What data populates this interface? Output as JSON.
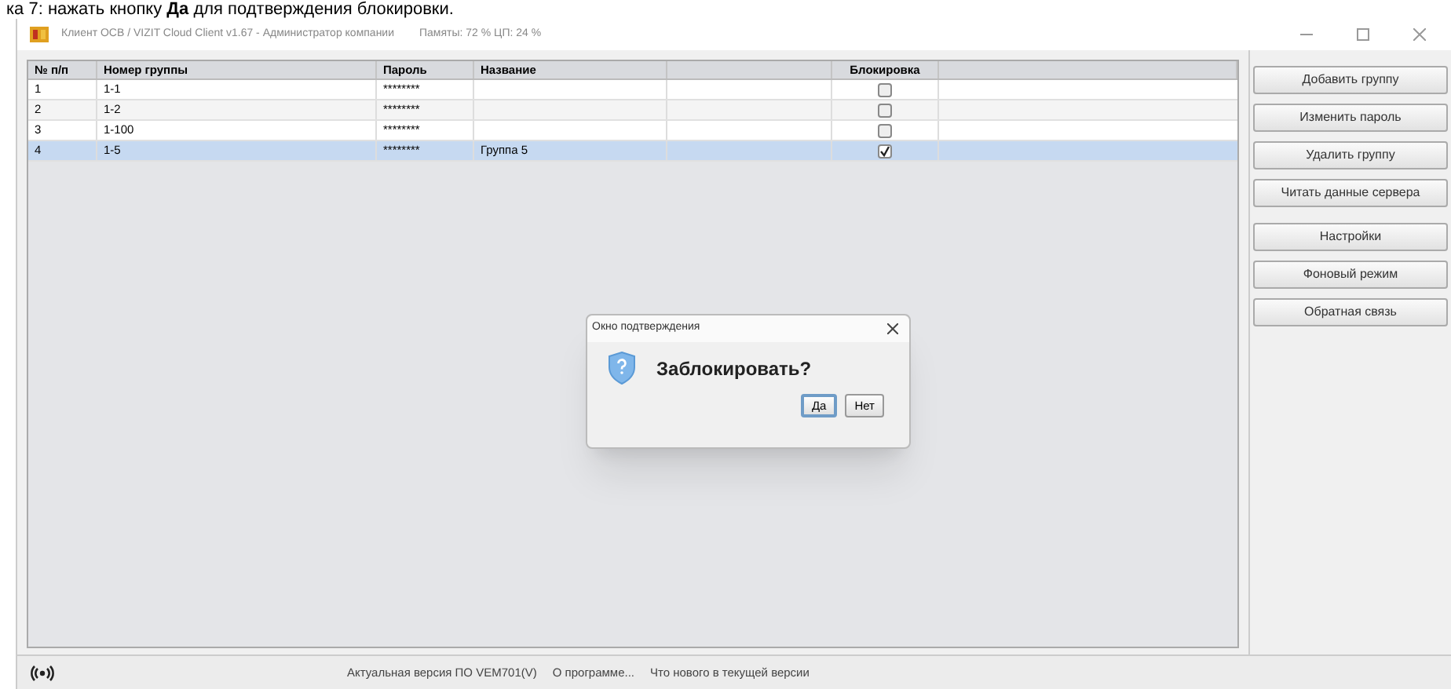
{
  "caption": "ка 7: нажать кнопку **Да** для подтверждения блокировки.",
  "window": {
    "title": "Клиент OCB / VIZIT Cloud Client v1.67 - Администратор компании",
    "memory": "Памяты: 72 %  ЦП: 24 %"
  },
  "table": {
    "columns": [
      "№ п/п",
      "Номер группы",
      "Пароль",
      "Название",
      "Блокировка"
    ],
    "rows": [
      {
        "n": "1",
        "group": "1-1",
        "password": "********",
        "name": "",
        "locked": false,
        "selected": false
      },
      {
        "n": "2",
        "group": "1-2",
        "password": "********",
        "name": "",
        "locked": false,
        "selected": false
      },
      {
        "n": "3",
        "group": "1-100",
        "password": "********",
        "name": "",
        "locked": false,
        "selected": false
      },
      {
        "n": "4",
        "group": "1-5",
        "password": "********",
        "name": "Группа 5",
        "locked": true,
        "selected": true
      }
    ]
  },
  "side_buttons": [
    [
      "Добавить группу",
      "Изменить пароль",
      "Удалить группу",
      "Читать данные сервера"
    ],
    [
      "Настройки",
      "Фоновый режим",
      "Обратная связь"
    ]
  ],
  "dialog": {
    "title": "Окно подтверждения",
    "message": "Заблокировать?",
    "buttons": [
      {
        "label": "Да",
        "selected": true
      },
      {
        "label": "Нет",
        "selected": false
      }
    ]
  },
  "status_bar": {
    "links": [
      "Актуальная версия ПО VEM701(V)",
      "О программе...",
      "Что нового в текущей версии"
    ]
  }
}
